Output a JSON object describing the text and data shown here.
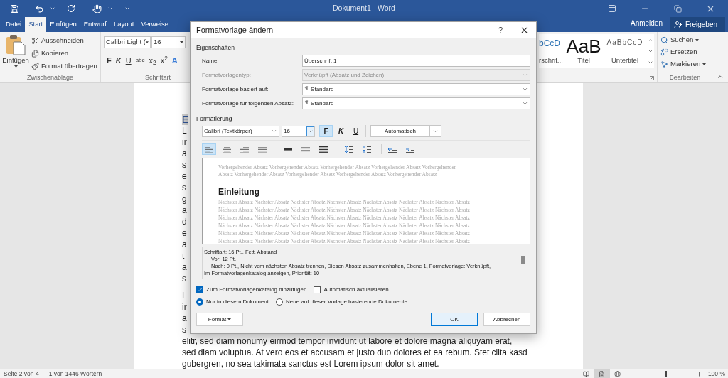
{
  "title_bar": {
    "title": "Dokument1 - Word"
  },
  "ribbon_tabs": [
    {
      "label": "Datei",
      "selected": false
    },
    {
      "label": "Start",
      "selected": true
    },
    {
      "label": "Einfügen",
      "selected": false
    },
    {
      "label": "Entwurf",
      "selected": false
    },
    {
      "label": "Layout",
      "selected": false
    },
    {
      "label": "Verweise",
      "selected": false
    }
  ],
  "account": {
    "sign_in": "Anmelden",
    "share": "Freigeben"
  },
  "clipboard_group": {
    "paste": "Einfügen",
    "label": "Zwischenablage",
    "items": [
      {
        "kind": "cut",
        "label": "Ausschneiden"
      },
      {
        "kind": "copy",
        "label": "Kopieren"
      },
      {
        "kind": "brush",
        "label": "Format übertragen"
      }
    ]
  },
  "font_group": {
    "font": "Calibri Light (",
    "size": "16",
    "label": "Schriftart",
    "buttons": [
      {
        "kind": "bold",
        "label": "F"
      },
      {
        "kind": "italic",
        "label": "K"
      },
      {
        "kind": "underline",
        "label": "U"
      },
      {
        "kind": "strike",
        "label": "abc"
      },
      {
        "kind": "sub",
        "label": "x$_{2}$"
      },
      {
        "kind": "sup",
        "label": "x$^{2}$"
      },
      {
        "kind": "effects",
        "label": "A"
      }
    ]
  },
  "styles_gallery": [
    {
      "kind": "heading",
      "sample": "bCcD",
      "name": "rschrif..."
    },
    {
      "kind": "title",
      "sample": "AaB",
      "name": "Titel"
    },
    {
      "kind": "subtitle",
      "sample": "AaBbCcD",
      "name": "Untertitel"
    }
  ],
  "editing_group": {
    "label": "Bearbeiten",
    "items": [
      {
        "kind": "search",
        "label": "Suchen"
      },
      {
        "kind": "replace",
        "label": "Ersetzen"
      },
      {
        "kind": "select",
        "label": "Markieren"
      }
    ]
  },
  "document": {
    "heading": "E",
    "paragraphs": [
      [
        "L",
        "ir",
        "a",
        "s",
        "e",
        "s",
        "g",
        "a",
        "d",
        "e",
        "a",
        "t",
        "a",
        "s"
      ],
      [
        "L",
        "ir",
        "a",
        "s",
        "elitr, sed diam nonumy eirmod tempor invidunt ut labore et dolore magna aliquyam erat,",
        "sed diam voluptua. At vero eos et accusam et justo duo dolores et ea rebum. Stet clita kasd",
        "gubergren, no sea takimata sanctus est Lorem ipsum dolor sit amet."
      ]
    ]
  },
  "status_bar": {
    "page": "Seite 2 von 4",
    "words": "1 von 1446 Wörtern",
    "views": [
      {
        "kind": "read",
        "selected": false
      },
      {
        "kind": "print",
        "selected": true
      },
      {
        "kind": "web",
        "selected": false
      }
    ],
    "zoom": {
      "level": 0.5,
      "reading": "100 %"
    }
  },
  "dialog": {
    "title": "Formatvorlage ändern",
    "help": "?",
    "properties_heading": "Eigenschaften",
    "fields": [
      {
        "kind": "text",
        "label": "Name:",
        "value": "Überschrift 1",
        "disabled": false
      },
      {
        "kind": "select",
        "label": "Formatvorlagentyp:",
        "value": "Verknüpft (Absatz und Zeichen)",
        "disabled": true
      },
      {
        "kind": "style-select",
        "label": "Formatvorlage basiert auf:",
        "value": "Standard",
        "disabled": false
      },
      {
        "kind": "style-select",
        "label": "Formatvorlage für folgenden Absatz:",
        "value": "Standard",
        "disabled": false
      }
    ],
    "formatting_heading": "Formatierung",
    "font": "Calibri (Textkörper)",
    "size": "16",
    "style_buttons": [
      {
        "kind": "bold",
        "label": "F",
        "selected": true
      },
      {
        "kind": "italic",
        "label": "K",
        "selected": false
      },
      {
        "kind": "underline",
        "label": "U",
        "selected": false
      }
    ],
    "color_select": "Automatisch",
    "paragraph_tools": [
      {
        "kind": "align-left",
        "selected": true
      },
      {
        "kind": "align-center",
        "selected": false
      },
      {
        "kind": "align-right",
        "selected": false
      },
      {
        "kind": "justify",
        "selected": false
      },
      {
        "kind": "single-spacing",
        "selected": false
      },
      {
        "kind": "one-half-spacing",
        "selected": false
      },
      {
        "kind": "double-spacing",
        "selected": false
      },
      {
        "kind": "space-before",
        "selected": false
      },
      {
        "kind": "space-after",
        "selected": false
      },
      {
        "kind": "outdent",
        "selected": false
      },
      {
        "kind": "indent",
        "selected": false
      }
    ],
    "preview": {
      "previous": [
        "Vorhergehender Absatz Vorhergehender Absatz Vorhergehender Absatz Vorhergehender Absatz Vorhergehender",
        "Absatz Vorhergehender Absatz Vorhergehender Absatz Vorhergehender Absatz Vorhergehender Absatz"
      ],
      "sample": "Einleitung",
      "next": [
        "Nächster Absatz Nächster Absatz Nächster Absatz Nächster Absatz Nächster Absatz Nächster Absatz Nächster Absatz",
        "Nächster Absatz Nächster Absatz Nächster Absatz Nächster Absatz Nächster Absatz Nächster Absatz Nächster Absatz",
        "Nächster Absatz Nächster Absatz Nächster Absatz Nächster Absatz Nächster Absatz Nächster Absatz Nächster Absatz",
        "Nächster Absatz Nächster Absatz Nächster Absatz Nächster Absatz Nächster Absatz Nächster Absatz Nächster Absatz",
        "Nächster Absatz Nächster Absatz Nächster Absatz Nächster Absatz Nächster Absatz Nächster Absatz Nächster Absatz",
        "Nächster Absatz Nächster Absatz Nächster Absatz Nächster Absatz Nächster Absatz Nächster Absatz Nächster Absatz"
      ]
    },
    "description": [
      {
        "text": "Schriftart: 16 Pt., Fett, Abstand",
        "indented": false
      },
      {
        "text": "Vor:  12 Pt.",
        "indented": true
      },
      {
        "text": "Nach:  0 Pt., Nicht vom nächsten Absatz trennen, Diesen Absatz zusammenhalten, Ebene 1, Formatvorlage: Verknüpft,",
        "indented": true
      },
      {
        "text": "Im Formatvorlagenkatalog anzeigen, Priorität: 10",
        "indented": false
      }
    ],
    "options": [
      {
        "label": "Zum Formatvorlagenkatalog hinzufügen",
        "checked": true
      },
      {
        "label": "Automatisch aktualisieren",
        "checked": false
      }
    ],
    "scope": [
      {
        "label": "Nur in diesem Dokument",
        "selected": true
      },
      {
        "label": "Neue auf dieser Vorlage basierende Dokumente",
        "selected": false
      }
    ],
    "buttons": [
      {
        "kind": "menu",
        "label": "Format"
      },
      {
        "kind": "default",
        "label": "OK"
      },
      {
        "kind": "plain",
        "label": "Abbrechen"
      }
    ]
  }
}
